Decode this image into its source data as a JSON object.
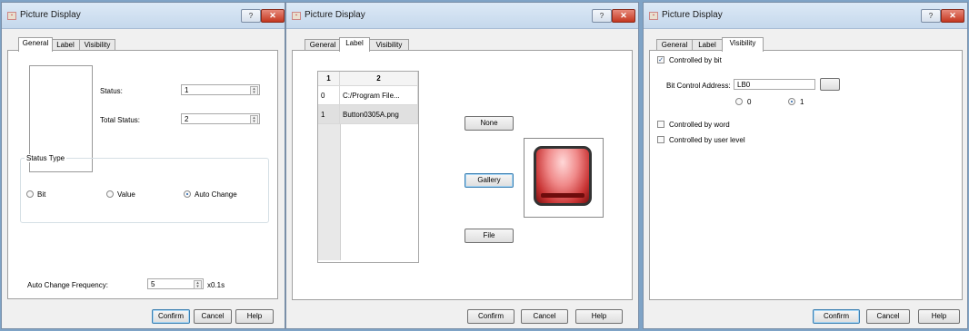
{
  "colors": {
    "accent": "#3c7fb1",
    "close": "#c4371f",
    "titlebar": "#d3e3f3"
  },
  "icons": {
    "app": "app-icon",
    "help": "question-icon",
    "close": "close-icon"
  },
  "win1": {
    "title": "Picture Display",
    "help": "?",
    "close": "✕",
    "tabs": [
      "General",
      "Label",
      "Visibility"
    ],
    "status_label": "Status:",
    "status_value": "1",
    "total_status_label": "Total Status:",
    "total_status_value": "2",
    "status_type_legend": "Status Type",
    "radio_bit": "Bit",
    "radio_value": "Value",
    "radio_auto": "Auto Change",
    "freq_label": "Auto Change Frequency:",
    "freq_value": "5",
    "freq_unit": "x0.1s",
    "confirm": "Confirm",
    "cancel": "Cancel",
    "help_btn": "Help"
  },
  "win2": {
    "title": "Picture Display",
    "help": "?",
    "close": "✕",
    "tabs": [
      "General",
      "Label",
      "Visibility"
    ],
    "col_headers": [
      "1",
      "2"
    ],
    "rows": [
      {
        "index": "0",
        "file": "C:/Program File..."
      },
      {
        "index": "1",
        "file": "Button0305A.png"
      }
    ],
    "none_btn": "None",
    "gallery_btn": "Gallery",
    "file_btn": "File",
    "confirm": "Confirm",
    "cancel": "Cancel",
    "help_btn": "Help"
  },
  "win3": {
    "title": "Picture Display",
    "help": "?",
    "close": "✕",
    "tabs": [
      "General",
      "Label",
      "Visibility"
    ],
    "controlled_by_bit": "Controlled by bit",
    "bit_address_label": "Bit Control Address:",
    "bit_address_value": "LB0",
    "radio_0": "0",
    "radio_1": "1",
    "controlled_by_word": "Controlled by word",
    "controlled_by_user": "Controlled by user level",
    "confirm": "Confirm",
    "cancel": "Cancel",
    "help_btn": "Help"
  }
}
